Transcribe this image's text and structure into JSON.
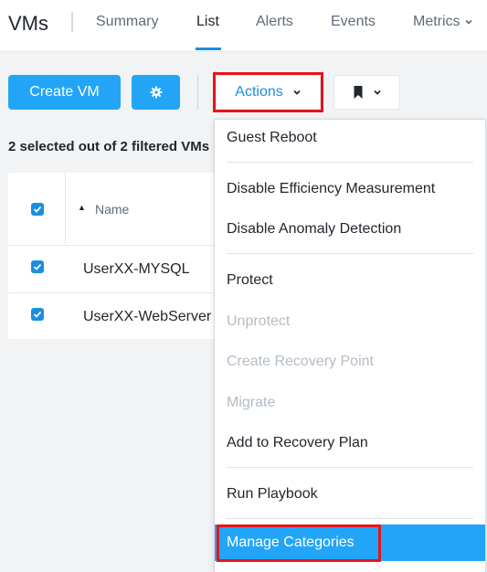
{
  "header": {
    "title": "VMs",
    "tabs": [
      {
        "label": "Summary"
      },
      {
        "label": "List"
      },
      {
        "label": "Alerts"
      },
      {
        "label": "Events"
      },
      {
        "label": "Metrics"
      }
    ],
    "active_tab": "List"
  },
  "toolbar": {
    "create_label": "Create VM",
    "settings_icon": "gear-icon",
    "actions_label": "Actions",
    "bookmark_icon": "bookmark-icon"
  },
  "selection": {
    "text": "2 selected out of 2 filtered VMs"
  },
  "table": {
    "columns": [
      "Name"
    ],
    "rows": [
      {
        "name": "UserXX-MYSQL",
        "checked": true
      },
      {
        "name": "UserXX-WebServer",
        "checked": true
      }
    ]
  },
  "actions_menu": {
    "items": [
      {
        "label": "Guest Reboot",
        "enabled": true
      },
      {
        "label": "Disable Efficiency Measurement",
        "enabled": true
      },
      {
        "label": "Disable Anomaly Detection",
        "enabled": true
      },
      {
        "label": "Protect",
        "enabled": true
      },
      {
        "label": "Unprotect",
        "enabled": false
      },
      {
        "label": "Create Recovery Point",
        "enabled": false
      },
      {
        "label": "Migrate",
        "enabled": false
      },
      {
        "label": "Add to Recovery Plan",
        "enabled": true
      },
      {
        "label": "Run Playbook",
        "enabled": true
      },
      {
        "label": "Manage Categories",
        "enabled": true,
        "selected": true
      }
    ]
  },
  "colors": {
    "primary": "#22a5f7",
    "link": "#1b8ee0",
    "highlight": "#e8141b"
  }
}
